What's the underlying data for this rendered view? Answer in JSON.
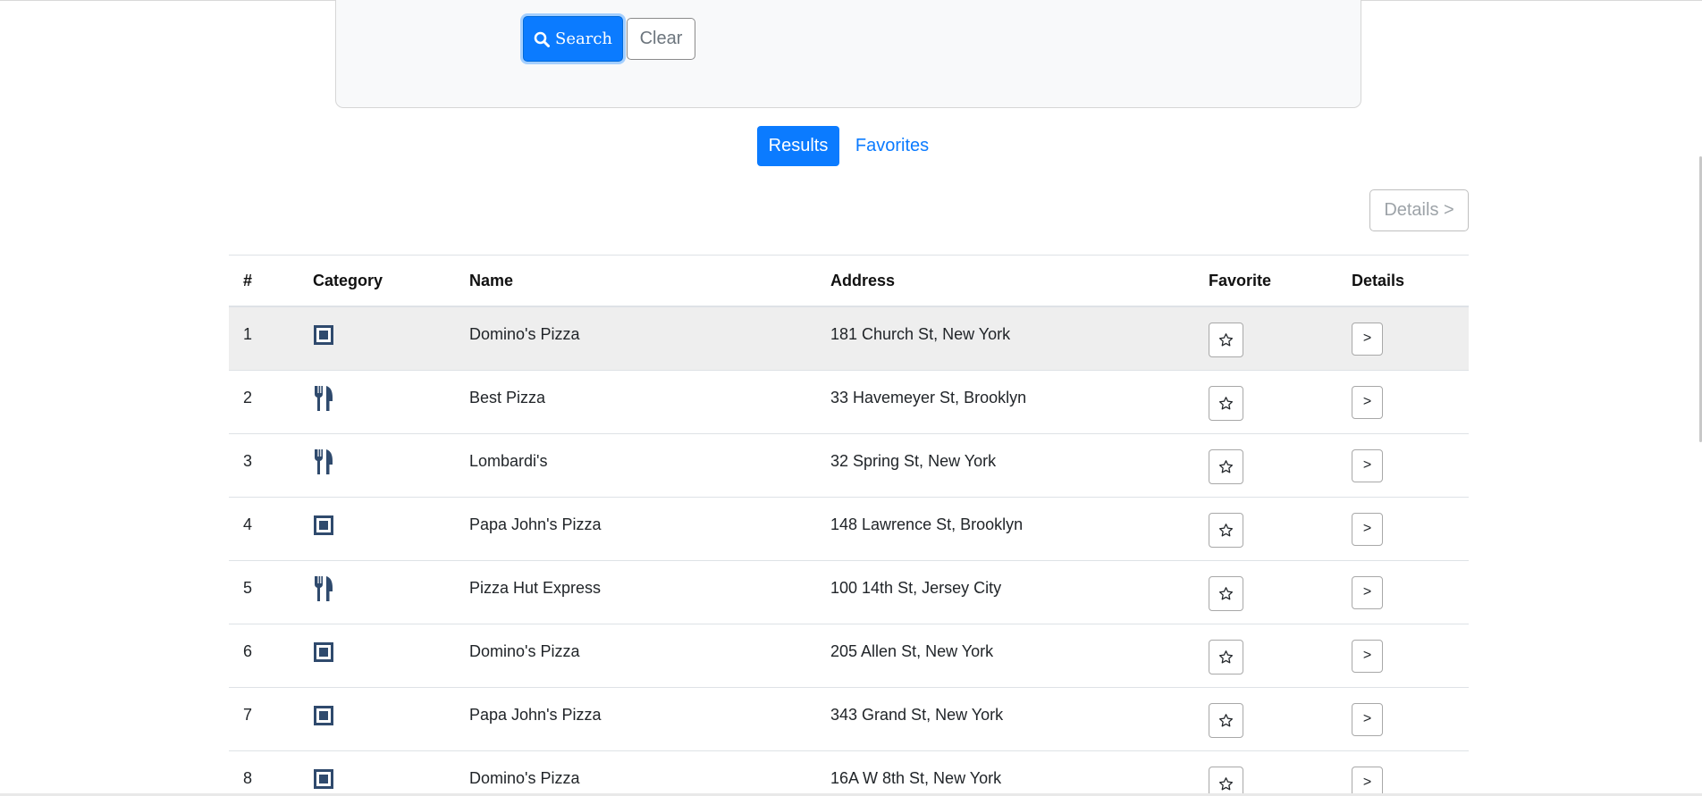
{
  "search": {
    "search_label": "Search",
    "clear_label": "Clear"
  },
  "tabs": {
    "results": "Results",
    "favorites": "Favorites",
    "active": "Results"
  },
  "toolbar": {
    "details_label": "Details >"
  },
  "table": {
    "headers": {
      "num": "#",
      "category": "Category",
      "name": "Name",
      "address": "Address",
      "favorite": "Favorite",
      "details": "Details"
    },
    "rows": [
      {
        "num": "1",
        "category_icon": "square-icon",
        "name": "Domino's Pizza",
        "address": "181 Church St, New York",
        "details_label": ">",
        "highlighted": true
      },
      {
        "num": "2",
        "category_icon": "fork-knife-icon",
        "name": "Best Pizza",
        "address": "33 Havemeyer St, Brooklyn",
        "details_label": ">"
      },
      {
        "num": "3",
        "category_icon": "fork-knife-icon",
        "name": "Lombardi's",
        "address": "32 Spring St, New York",
        "details_label": ">"
      },
      {
        "num": "4",
        "category_icon": "square-icon",
        "name": "Papa John's Pizza",
        "address": "148 Lawrence St, Brooklyn",
        "details_label": ">"
      },
      {
        "num": "5",
        "category_icon": "fork-knife-icon",
        "name": "Pizza Hut Express",
        "address": "100 14th St, Jersey City",
        "details_label": ">"
      },
      {
        "num": "6",
        "category_icon": "square-icon",
        "name": "Domino's Pizza",
        "address": "205 Allen St, New York",
        "details_label": ">"
      },
      {
        "num": "7",
        "category_icon": "square-icon",
        "name": "Papa John's Pizza",
        "address": "343 Grand St, New York",
        "details_label": ">"
      },
      {
        "num": "8",
        "category_icon": "square-icon",
        "name": "Domino's Pizza",
        "address": "16A W 8th St, New York",
        "details_label": ">"
      }
    ]
  },
  "colors": {
    "primary": "#0b7bff",
    "category_icon": "#2f4a6d",
    "highlight_row": "#eeeeee"
  }
}
